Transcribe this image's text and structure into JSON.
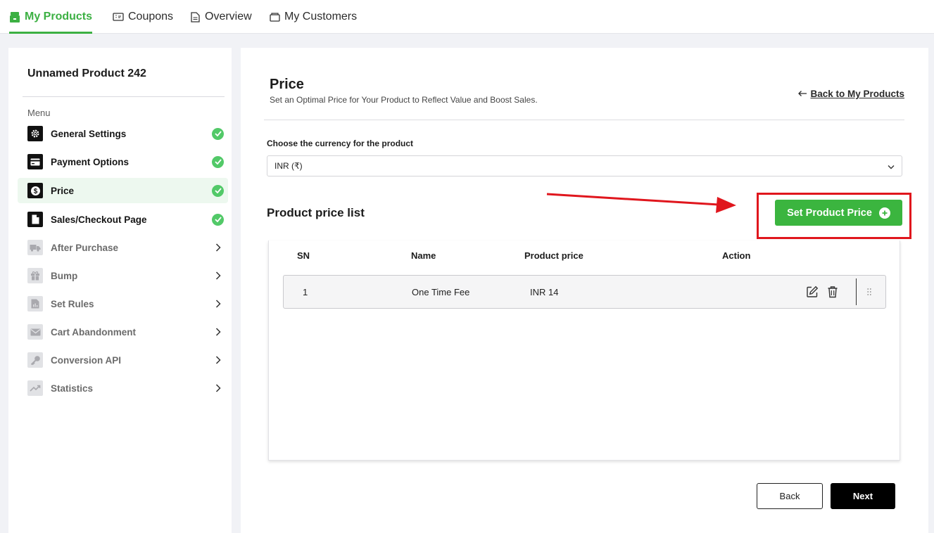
{
  "nav": {
    "tabs": [
      {
        "label": "My Products",
        "icon": "store-icon",
        "active": true
      },
      {
        "label": "Coupons",
        "icon": "ticket-icon"
      },
      {
        "label": "Overview",
        "icon": "document-icon"
      },
      {
        "label": "My Customers",
        "icon": "wallet-icon"
      }
    ],
    "accent": "#3cb043"
  },
  "sidebar": {
    "product_title": "Unnamed Product 242",
    "menu_label": "Menu",
    "items": [
      {
        "label": "General Settings",
        "icon": "gear-icon",
        "status": "completed"
      },
      {
        "label": "Payment Options",
        "icon": "card-icon",
        "status": "completed"
      },
      {
        "label": "Price",
        "icon": "dollar-icon",
        "status": "completed",
        "selected": true
      },
      {
        "label": "Sales/Checkout Page",
        "icon": "page-icon",
        "status": "completed"
      },
      {
        "label": "After Purchase",
        "icon": "truck-icon",
        "status": "pending"
      },
      {
        "label": "Bump",
        "icon": "gift-icon",
        "status": "pending"
      },
      {
        "label": "Set Rules",
        "icon": "rules-icon",
        "status": "pending"
      },
      {
        "label": "Cart Abandonment",
        "icon": "mail-icon",
        "status": "pending"
      },
      {
        "label": "Conversion API",
        "icon": "key-icon",
        "status": "pending"
      },
      {
        "label": "Statistics",
        "icon": "trend-icon",
        "status": "pending"
      }
    ]
  },
  "main": {
    "title": "Price",
    "subtitle": "Set an Optimal Price for Your Product to Reflect Value and Boost Sales.",
    "back_link": "Back to My Products",
    "currency": {
      "label": "Choose the currency for the product",
      "value": "INR (₹)"
    },
    "price_list": {
      "title": "Product price list",
      "add_button": "Set Product Price",
      "columns": [
        "SN",
        "Name",
        "Product price",
        "Action"
      ],
      "rows": [
        {
          "sn": "1",
          "name": "One Time Fee",
          "price": "INR 14"
        }
      ]
    },
    "footer": {
      "back": "Back",
      "next": "Next"
    },
    "colors": {
      "primary_green": "#3bb53f",
      "annotation_red": "#e0161d"
    }
  }
}
